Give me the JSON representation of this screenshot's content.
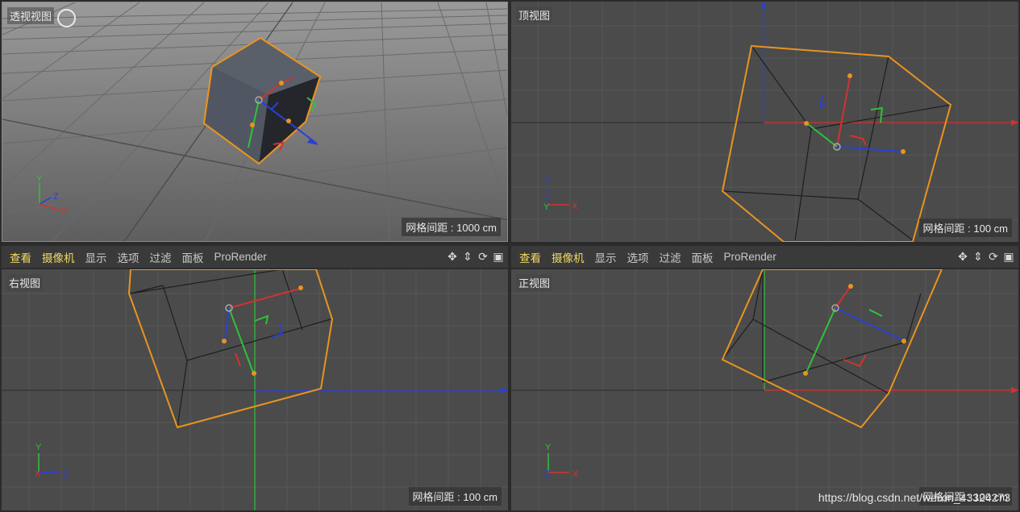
{
  "viewports": {
    "perspective": {
      "label": "透视视图",
      "grid_spacing": "网格间距 : 1000 cm"
    },
    "top": {
      "label": "顶视图",
      "grid_spacing": "网格间距 : 100 cm"
    },
    "right": {
      "label": "右视图",
      "grid_spacing": "网格间距 : 100 cm"
    },
    "front": {
      "label": "正视图",
      "grid_spacing": "网格间距 : 100 cm"
    }
  },
  "toolbar": {
    "menu": [
      "查看",
      "摄像机",
      "显示",
      "选项",
      "过滤",
      "面板",
      "ProRender"
    ],
    "tools": [
      "move-view-icon",
      "dolly-view-icon",
      "rotate-view-icon",
      "toggle-viewport-icon"
    ]
  },
  "axis_labels": {
    "x": "X",
    "y": "Y",
    "z": "Z"
  },
  "watermark": "https://blog.csdn.net/weixin_43324273",
  "colors": {
    "selection": "#e8941f",
    "axis_x": "#d23232",
    "axis_y": "#2fc23a",
    "axis_z": "#2b3fd6",
    "viewport_bg": "#4b4b4b",
    "toolbar_active": "#f2d860"
  }
}
